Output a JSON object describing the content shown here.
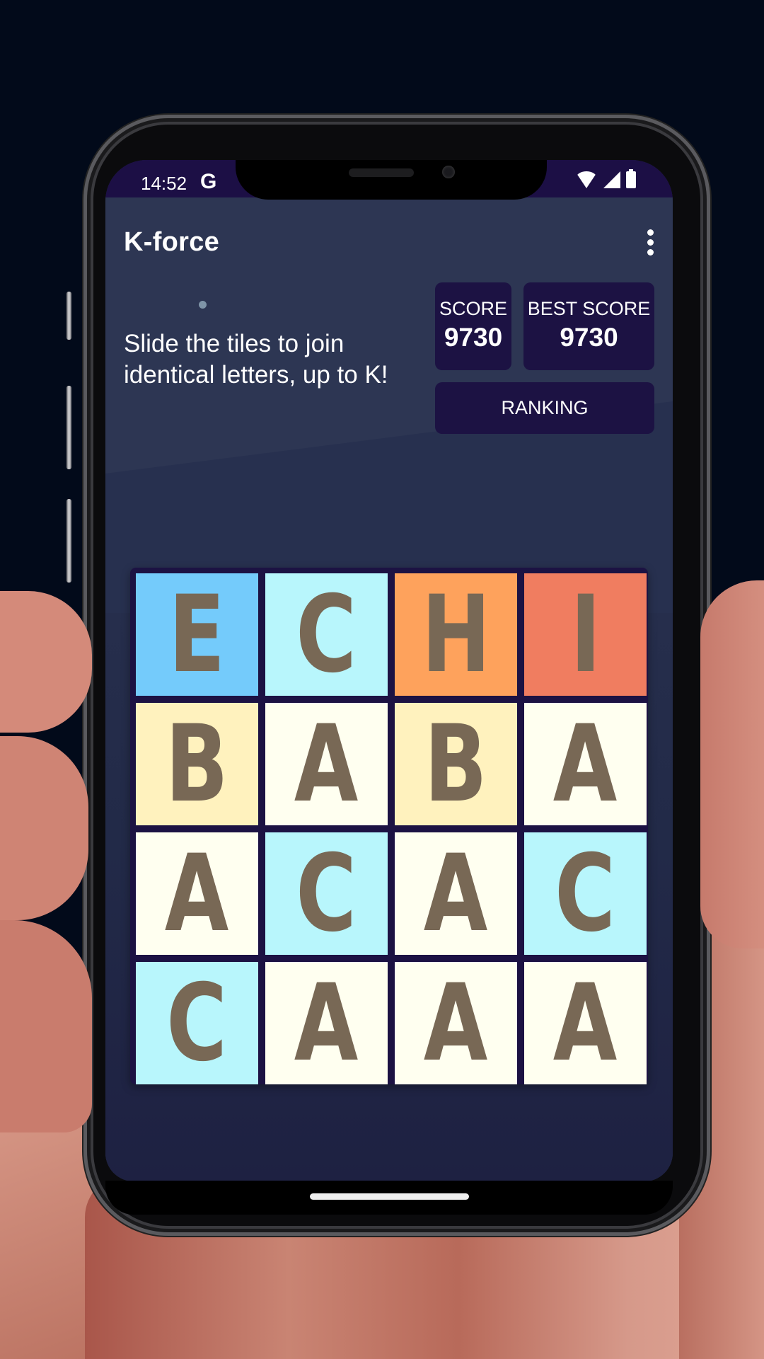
{
  "status_bar": {
    "time": "14:52",
    "notification_icon": "google-g-icon",
    "icons": [
      "wifi-icon",
      "signal-icon",
      "battery-icon"
    ]
  },
  "app": {
    "title": "K-force",
    "menu_icon": "more-vert-icon",
    "instruction": "Slide the tiles to join identical letters, up to K!"
  },
  "scores": {
    "score_label": "SCORE",
    "score_value": "9730",
    "best_label": "BEST SCORE",
    "best_value": "9730",
    "ranking_label": "RANKING"
  },
  "board": {
    "rows": [
      [
        {
          "letter": "E",
          "color": "#74cbfb"
        },
        {
          "letter": "C",
          "color": "#b8f6fc"
        },
        {
          "letter": "H",
          "color": "#fea25c"
        },
        {
          "letter": "I",
          "color": "#f07d60"
        }
      ],
      [
        {
          "letter": "B",
          "color": "#fff2be"
        },
        {
          "letter": "A",
          "color": "#fffff0"
        },
        {
          "letter": "B",
          "color": "#fff2be"
        },
        {
          "letter": "A",
          "color": "#fffff0"
        }
      ],
      [
        {
          "letter": "A",
          "color": "#fffff0"
        },
        {
          "letter": "C",
          "color": "#b8f6fc"
        },
        {
          "letter": "A",
          "color": "#fffff0"
        },
        {
          "letter": "C",
          "color": "#b8f6fc"
        }
      ],
      [
        {
          "letter": "C",
          "color": "#b8f6fc"
        },
        {
          "letter": "A",
          "color": "#fffff0"
        },
        {
          "letter": "A",
          "color": "#fffff0"
        },
        {
          "letter": "A",
          "color": "#fffff0"
        }
      ]
    ],
    "letter_color": "#786855",
    "frame_color": "#1c1243"
  },
  "colors": {
    "status_bar": "#1c0f45",
    "background": "#27304f",
    "panel": "#1c1243"
  }
}
